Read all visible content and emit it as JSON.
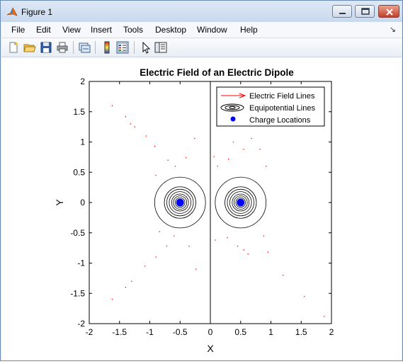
{
  "window": {
    "title": "Figure 1",
    "app_icon": "matlab-icon",
    "caption_buttons": [
      "minimize-icon",
      "maximize-icon",
      "close-icon"
    ]
  },
  "menu": {
    "items": [
      {
        "label": "File"
      },
      {
        "label": "Edit"
      },
      {
        "label": "View"
      },
      {
        "label": "Insert"
      },
      {
        "label": "Tools"
      },
      {
        "label": "Desktop"
      },
      {
        "label": "Window"
      },
      {
        "label": "Help"
      }
    ]
  },
  "toolbar": {
    "tools": [
      "new-figure-icon",
      "open-file-icon",
      "save-icon",
      "print-icon",
      "link-icon",
      "colorbar-icon",
      "legend-icon",
      "pointer-icon",
      "property-editor-icon"
    ]
  },
  "chart_data": {
    "type": "scatter",
    "title": "Electric Field of an Electric Dipole",
    "xlabel": "X",
    "ylabel": "Y",
    "xlim": [
      -2,
      2
    ],
    "ylim": [
      -2,
      2
    ],
    "x_ticks": [
      -2,
      -1.5,
      -1,
      -0.5,
      0,
      0.5,
      1,
      1.5,
      2
    ],
    "y_ticks": [
      -2,
      -1.5,
      -1,
      -0.5,
      0,
      0.5,
      1,
      1.5,
      2
    ],
    "x_tick_labels": [
      "-2",
      "-1.5",
      "-1",
      "-0.5",
      "0",
      "0.5",
      "1",
      "1.5",
      "2"
    ],
    "y_tick_labels": [
      "-2",
      "-1.5",
      "-1",
      "-0.5",
      "0",
      "0.5",
      "1",
      "1.5",
      "2"
    ],
    "grid": false,
    "legend": {
      "position": "top-right",
      "entries": [
        "Electric Field Lines",
        "Equipotential Lines",
        "Charge Locations"
      ]
    },
    "colors": {
      "field_lines": "#ff0000",
      "equipotential": "#000000",
      "charges": "#0000ff"
    },
    "charges": [
      {
        "x": -0.5,
        "y": 0
      },
      {
        "x": 0.5,
        "y": 0
      }
    ],
    "equipotential_radii": [
      0.05,
      0.08,
      0.11,
      0.14,
      0.18,
      0.22,
      0.26,
      0.42
    ],
    "field_points": [
      {
        "x": -1.62,
        "y": 1.6
      },
      {
        "x": -1.4,
        "y": 1.42
      },
      {
        "x": -1.32,
        "y": 1.3
      },
      {
        "x": -1.25,
        "y": 1.25
      },
      {
        "x": -1.06,
        "y": 1.1
      },
      {
        "x": -0.92,
        "y": 0.93
      },
      {
        "x": -0.7,
        "y": 0.7
      },
      {
        "x": -0.58,
        "y": 0.6
      },
      {
        "x": -0.4,
        "y": 0.74
      },
      {
        "x": -0.26,
        "y": 1.06
      },
      {
        "x": -1.62,
        "y": -1.6
      },
      {
        "x": -1.4,
        "y": -1.4
      },
      {
        "x": -1.3,
        "y": -1.3
      },
      {
        "x": -1.08,
        "y": -1.05
      },
      {
        "x": -0.9,
        "y": -0.9
      },
      {
        "x": -0.72,
        "y": -0.72
      },
      {
        "x": -0.6,
        "y": -0.55
      },
      {
        "x": -0.35,
        "y": -0.72
      },
      {
        "x": -0.24,
        "y": -1.1
      },
      {
        "x": -0.84,
        "y": -0.48
      },
      {
        "x": -0.9,
        "y": 0.45
      },
      {
        "x": 0.06,
        "y": 0.76
      },
      {
        "x": 0.12,
        "y": 0.6
      },
      {
        "x": 0.3,
        "y": 0.72
      },
      {
        "x": 0.38,
        "y": 1.0
      },
      {
        "x": 0.55,
        "y": 0.88
      },
      {
        "x": 0.68,
        "y": 1.06
      },
      {
        "x": 0.82,
        "y": 0.88
      },
      {
        "x": 0.92,
        "y": 0.6
      },
      {
        "x": 1.22,
        "y": 1.56
      },
      {
        "x": 1.55,
        "y": 1.72
      },
      {
        "x": 1.6,
        "y": 1.78
      },
      {
        "x": 0.08,
        "y": -0.62
      },
      {
        "x": 0.28,
        "y": -0.58
      },
      {
        "x": 0.45,
        "y": -0.72
      },
      {
        "x": 0.55,
        "y": -0.78
      },
      {
        "x": 0.62,
        "y": -0.85
      },
      {
        "x": 0.95,
        "y": -0.82
      },
      {
        "x": 1.2,
        "y": -1.2
      },
      {
        "x": 1.55,
        "y": -1.55
      },
      {
        "x": 1.88,
        "y": -1.88
      },
      {
        "x": 0.88,
        "y": -0.55
      }
    ]
  }
}
